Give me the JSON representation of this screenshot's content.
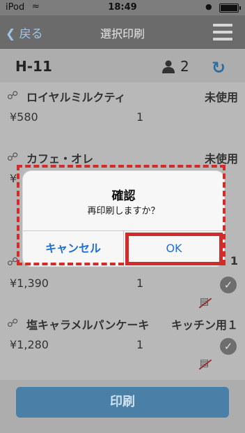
{
  "status": {
    "carrier": "iPod",
    "time": "18:49"
  },
  "nav": {
    "back_label": "戻る",
    "title": "選択印刷"
  },
  "order": {
    "table_id": "H-11",
    "guests": "2"
  },
  "items": [
    {
      "name": "ロイヤルミルクティ",
      "status": "未使用",
      "price": "¥580",
      "qty": "1"
    },
    {
      "name": "カフェ・オレ",
      "status": "未使用",
      "price": "¥",
      "qty": ""
    },
    {
      "name": "",
      "status": "1",
      "price": "¥1,390",
      "qty": "1"
    },
    {
      "name": "塩キャラメルパンケーキ",
      "status": "キッチン用１",
      "price": "¥1,280",
      "qty": "1"
    }
  ],
  "footer": {
    "print_label": "印刷"
  },
  "dialog": {
    "title": "確認",
    "message": "再印刷しますか？",
    "cancel_label": "キャンセル",
    "ok_label": "OK"
  },
  "colors": {
    "highlight": "#d32a2a",
    "accent": "#1e6fd6",
    "print_button": "#4a7fa8"
  }
}
